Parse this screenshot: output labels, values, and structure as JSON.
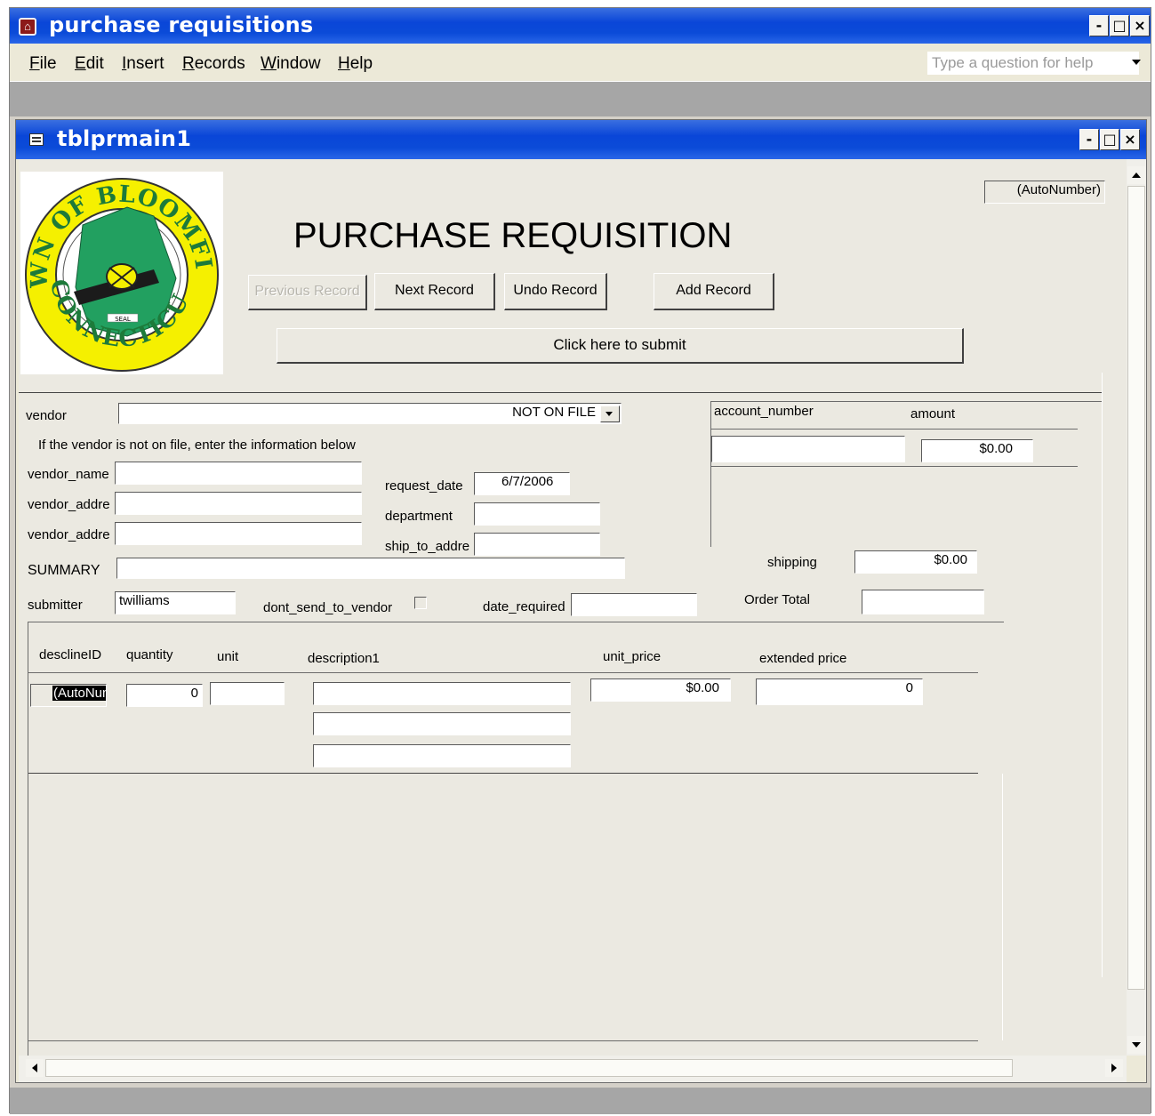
{
  "app": {
    "title": "purchase requisitions",
    "menu": [
      "File",
      "Edit",
      "Insert",
      "Records",
      "Window",
      "Help"
    ],
    "help_placeholder": "Type a question for help"
  },
  "child": {
    "title": "tblprmain1"
  },
  "header": {
    "heading": "PURCHASE REQUISITION",
    "autonumber": "(AutoNumber)",
    "buttons": {
      "previous": "Previous Record",
      "next": "Next Record",
      "undo": "Undo Record",
      "add": "Add Record",
      "submit": "Click here to submit"
    },
    "logo": {
      "top_text": "TOWN OF BLOOMFIELD",
      "bottom_text": "CONNECTICUT",
      "seal": "SEAL"
    }
  },
  "vendor": {
    "label": "vendor",
    "value": "NOT ON FILE",
    "note": "If the vendor is not on file, enter the information below",
    "name_label": "vendor_name",
    "addr1_label": "vendor_addre",
    "addr2_label": "vendor_addre"
  },
  "request": {
    "date_label": "request_date",
    "date_value": "6/7/2006",
    "department_label": "department",
    "ship_label": "ship_to_addre"
  },
  "accounts": {
    "col_account": "account_number",
    "col_amount": "amount",
    "amount_value": "$0.00"
  },
  "summary": {
    "label": "SUMMARY",
    "submitter_label": "submitter",
    "submitter_value": "twilliams",
    "dont_send_label": "dont_send_to_vendor",
    "date_required_label": "date_required",
    "shipping_label": "shipping",
    "shipping_value": "$0.00",
    "order_total_label": "Order Total"
  },
  "lines": {
    "headers": {
      "id": "desclineID",
      "quantity": "quantity",
      "unit": "unit",
      "description": "description1",
      "unit_price": "unit_price",
      "extended": "extended price"
    },
    "row": {
      "id": "(AutoNumber)",
      "quantity": "0",
      "unit_price": "$0.00",
      "extended": "0"
    }
  }
}
